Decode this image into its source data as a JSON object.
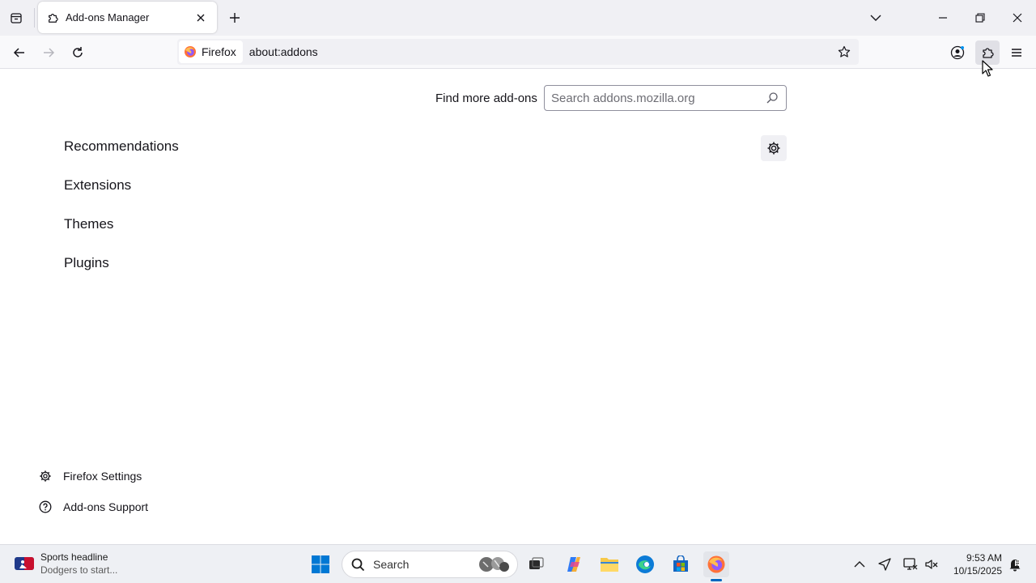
{
  "browser": {
    "tab": {
      "title": "Add-ons Manager"
    },
    "identity_label": "Firefox",
    "url": "about:addons"
  },
  "addons_page": {
    "find_more_label": "Find more add-ons",
    "search_placeholder": "Search addons.mozilla.org",
    "categories": [
      "Recommendations",
      "Extensions",
      "Themes",
      "Plugins"
    ],
    "footer": {
      "settings_label": "Firefox Settings",
      "support_label": "Add-ons Support"
    }
  },
  "taskbar": {
    "widget_title": "Sports headline",
    "widget_subtitle": "Dodgers to start...",
    "search_label": "Search",
    "time": "9:53 AM",
    "date": "10/15/2025"
  },
  "colors": {
    "accent": "#0067c0",
    "tab_strip_bg": "#f0f0f4",
    "text": "#15141a"
  }
}
